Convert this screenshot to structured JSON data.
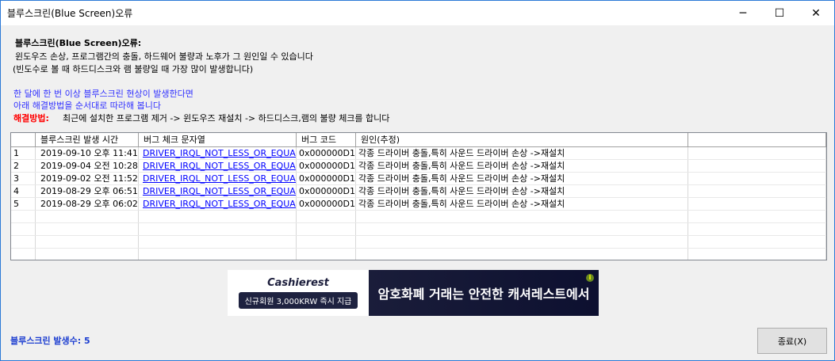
{
  "window": {
    "title": "블루스크린(Blue Screen)오류",
    "minimize": "─",
    "maximize": "☐",
    "close": "✕"
  },
  "info": {
    "heading": "블루스크린(Blue Screen)오류:",
    "line1": "윈도우즈 손상, 프로그램간의 충돌, 하드웨어 불량과 노후가 그 원인일 수 있습니다",
    "line2": "(빈도수로 볼 때 하드디스크와 램 불량일 때 가장 많이 발생합니다)",
    "blue1": "한 달에 한 번 이상 블루스크린 현상이 발생한다면",
    "blue2": "아래 해결방법을 순서대로 따라해 봅니다",
    "solution_label": "해결방법:",
    "solution_text": "최근에 설치한 프로그램 제거 -> 윈도우즈 재설치 -> 하드디스크,램의 불량 체크를 합니다"
  },
  "table": {
    "headers": [
      "",
      "블루스크린 발생 시간",
      "버그 체크 문자열",
      "버그 코드",
      "원인(추정)",
      ""
    ],
    "rows": [
      [
        "1",
        "2019-09-10 오후 11:41",
        "DRIVER_IRQL_NOT_LESS_OR_EQUAL",
        "0x000000D1",
        "각종 드라이버 충돌,특히 사운드 드라이버 손상 ->재설치"
      ],
      [
        "2",
        "2019-09-04 오전 10:28",
        "DRIVER_IRQL_NOT_LESS_OR_EQUAL",
        "0x000000D1",
        "각종 드라이버 충돌,특히 사운드 드라이버 손상 ->재설치"
      ],
      [
        "3",
        "2019-09-02 오전 11:52",
        "DRIVER_IRQL_NOT_LESS_OR_EQUAL",
        "0x000000D1",
        "각종 드라이버 충돌,특히 사운드 드라이버 손상 ->재설치"
      ],
      [
        "4",
        "2019-08-29 오후 06:51",
        "DRIVER_IRQL_NOT_LESS_OR_EQUAL",
        "0x000000D1",
        "각종 드라이버 충돌,특히 사운드 드라이버 손상 ->재설치"
      ],
      [
        "5",
        "2019-08-29 오후 06:02",
        "DRIVER_IRQL_NOT_LESS_OR_EQUAL",
        "0x000000D1",
        "각종 드라이버 충돌,특히 사운드 드라이버 손상 ->재설치"
      ]
    ]
  },
  "ad": {
    "logo": "Cashierest",
    "promo": "신규회원 3,000KRW 즉시 지급",
    "headline": "암호화폐 거래는 안전한 캐셔레스트에서",
    "info": "i"
  },
  "footer": {
    "count": "블루스크린 발생수: 5",
    "close_label": "종료(X)"
  }
}
